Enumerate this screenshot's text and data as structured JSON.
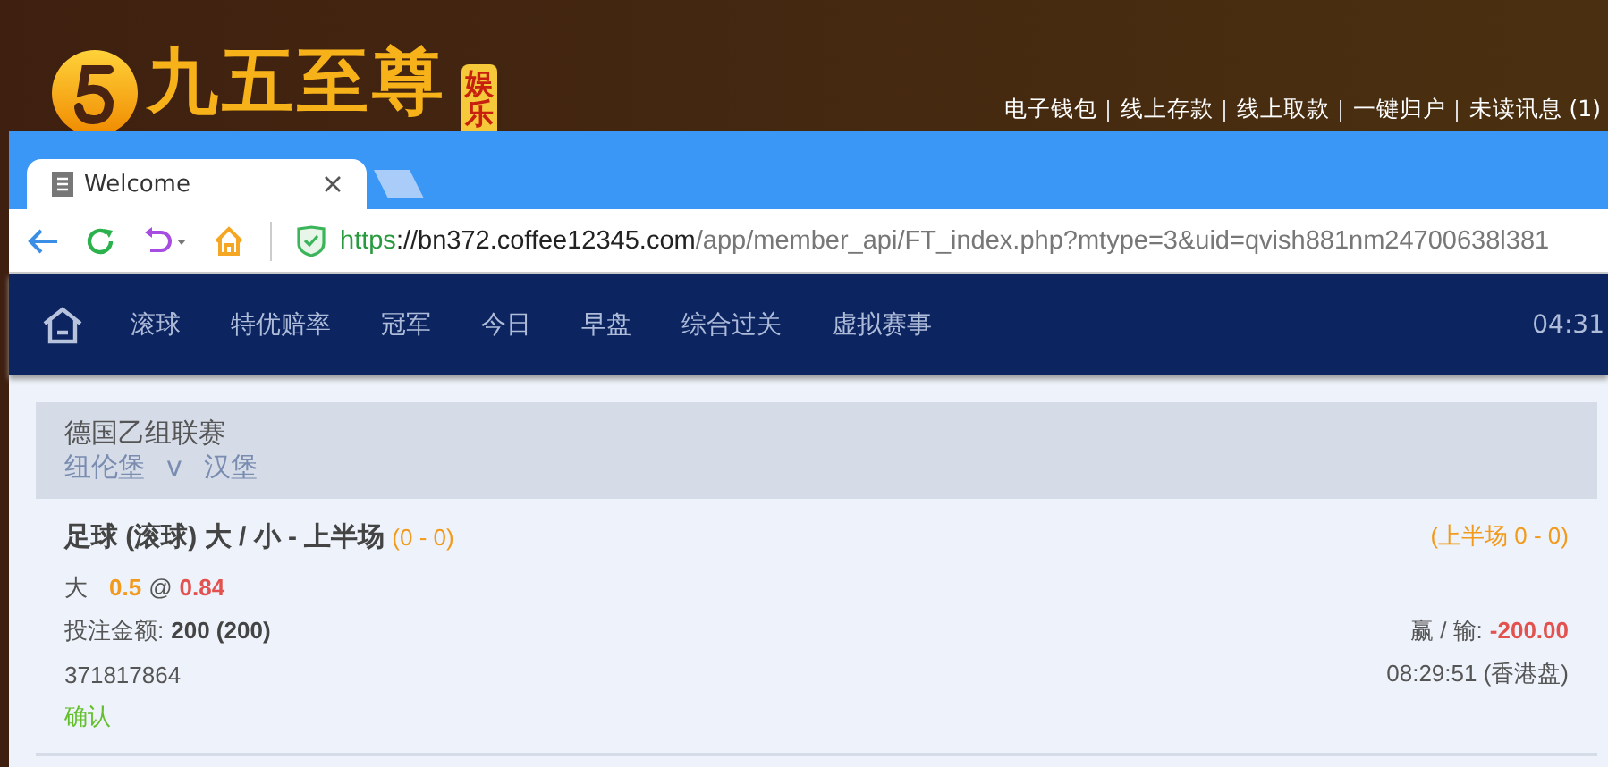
{
  "site_header": {
    "logo_text": "九五至尊",
    "logo_badge": [
      "娱",
      "乐"
    ],
    "links": [
      "电子钱包",
      "线上存款",
      "线上取款",
      "一键归户",
      "未读讯息 (1)"
    ]
  },
  "browser": {
    "tabs": [
      {
        "title": "Welcome",
        "selected": true
      }
    ],
    "address": {
      "scheme": "https",
      "host": "://bn372.coffee12345.com",
      "path": "/app/member_api/FT_index.php?mtype=3&uid=qvish881nm24700638l381"
    }
  },
  "nav": {
    "items": [
      "滚球",
      "特优赔率",
      "冠军",
      "今日",
      "早盘",
      "综合过关",
      "虚拟赛事"
    ],
    "clock": "04:31"
  },
  "bet": {
    "league": "德国乙组联赛",
    "home": "纽伦堡",
    "versus": "v",
    "away": "汉堡",
    "market": "足球 (滚球) 大 / 小 - 上半场",
    "score": "(0 - 0)",
    "half_score": "(上半场 0 - 0)",
    "selection": "大",
    "line": "0.5",
    "at": "@",
    "odds": "0.84",
    "stake_label": "投注金额:",
    "stake": "200 (200)",
    "result_label": "赢 / 输:",
    "result": "-200.00",
    "ticket": "371817864",
    "time": "08:29:51 (香港盘)",
    "status": "确认"
  }
}
